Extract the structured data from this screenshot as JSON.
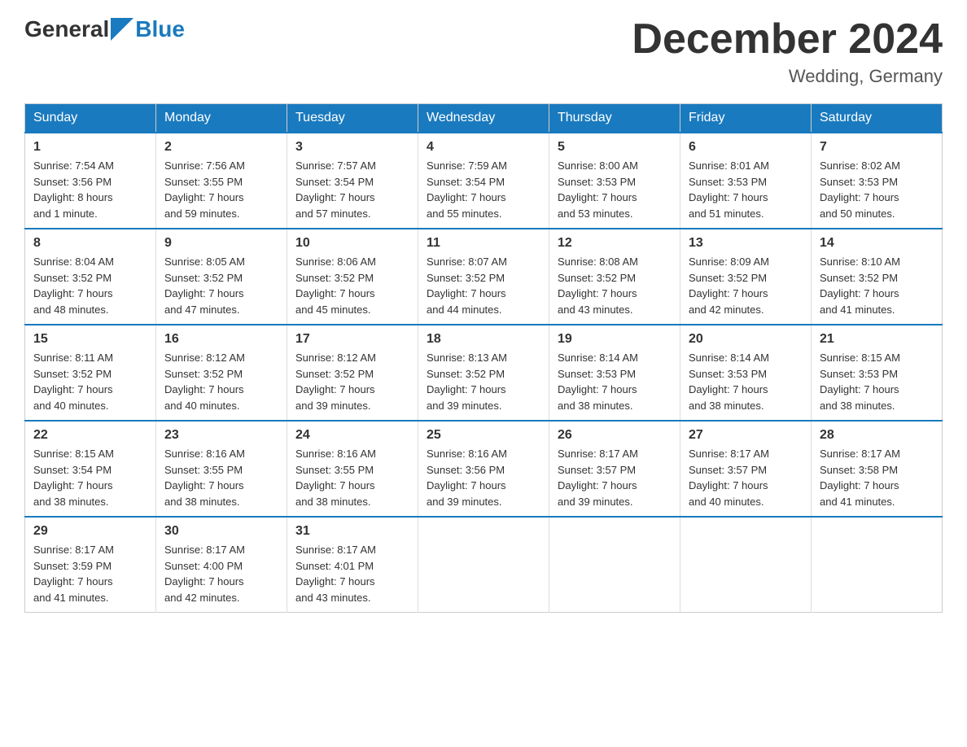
{
  "header": {
    "logo": {
      "part1": "General",
      "part2": "Blue"
    },
    "title": "December 2024",
    "location": "Wedding, Germany"
  },
  "weekdays": [
    "Sunday",
    "Monday",
    "Tuesday",
    "Wednesday",
    "Thursday",
    "Friday",
    "Saturday"
  ],
  "weeks": [
    [
      {
        "day": "1",
        "sunrise": "7:54 AM",
        "sunset": "3:56 PM",
        "daylight": "8 hours and 1 minute."
      },
      {
        "day": "2",
        "sunrise": "7:56 AM",
        "sunset": "3:55 PM",
        "daylight": "7 hours and 59 minutes."
      },
      {
        "day": "3",
        "sunrise": "7:57 AM",
        "sunset": "3:54 PM",
        "daylight": "7 hours and 57 minutes."
      },
      {
        "day": "4",
        "sunrise": "7:59 AM",
        "sunset": "3:54 PM",
        "daylight": "7 hours and 55 minutes."
      },
      {
        "day": "5",
        "sunrise": "8:00 AM",
        "sunset": "3:53 PM",
        "daylight": "7 hours and 53 minutes."
      },
      {
        "day": "6",
        "sunrise": "8:01 AM",
        "sunset": "3:53 PM",
        "daylight": "7 hours and 51 minutes."
      },
      {
        "day": "7",
        "sunrise": "8:02 AM",
        "sunset": "3:53 PM",
        "daylight": "7 hours and 50 minutes."
      }
    ],
    [
      {
        "day": "8",
        "sunrise": "8:04 AM",
        "sunset": "3:52 PM",
        "daylight": "7 hours and 48 minutes."
      },
      {
        "day": "9",
        "sunrise": "8:05 AM",
        "sunset": "3:52 PM",
        "daylight": "7 hours and 47 minutes."
      },
      {
        "day": "10",
        "sunrise": "8:06 AM",
        "sunset": "3:52 PM",
        "daylight": "7 hours and 45 minutes."
      },
      {
        "day": "11",
        "sunrise": "8:07 AM",
        "sunset": "3:52 PM",
        "daylight": "7 hours and 44 minutes."
      },
      {
        "day": "12",
        "sunrise": "8:08 AM",
        "sunset": "3:52 PM",
        "daylight": "7 hours and 43 minutes."
      },
      {
        "day": "13",
        "sunrise": "8:09 AM",
        "sunset": "3:52 PM",
        "daylight": "7 hours and 42 minutes."
      },
      {
        "day": "14",
        "sunrise": "8:10 AM",
        "sunset": "3:52 PM",
        "daylight": "7 hours and 41 minutes."
      }
    ],
    [
      {
        "day": "15",
        "sunrise": "8:11 AM",
        "sunset": "3:52 PM",
        "daylight": "7 hours and 40 minutes."
      },
      {
        "day": "16",
        "sunrise": "8:12 AM",
        "sunset": "3:52 PM",
        "daylight": "7 hours and 40 minutes."
      },
      {
        "day": "17",
        "sunrise": "8:12 AM",
        "sunset": "3:52 PM",
        "daylight": "7 hours and 39 minutes."
      },
      {
        "day": "18",
        "sunrise": "8:13 AM",
        "sunset": "3:52 PM",
        "daylight": "7 hours and 39 minutes."
      },
      {
        "day": "19",
        "sunrise": "8:14 AM",
        "sunset": "3:53 PM",
        "daylight": "7 hours and 38 minutes."
      },
      {
        "day": "20",
        "sunrise": "8:14 AM",
        "sunset": "3:53 PM",
        "daylight": "7 hours and 38 minutes."
      },
      {
        "day": "21",
        "sunrise": "8:15 AM",
        "sunset": "3:53 PM",
        "daylight": "7 hours and 38 minutes."
      }
    ],
    [
      {
        "day": "22",
        "sunrise": "8:15 AM",
        "sunset": "3:54 PM",
        "daylight": "7 hours and 38 minutes."
      },
      {
        "day": "23",
        "sunrise": "8:16 AM",
        "sunset": "3:55 PM",
        "daylight": "7 hours and 38 minutes."
      },
      {
        "day": "24",
        "sunrise": "8:16 AM",
        "sunset": "3:55 PM",
        "daylight": "7 hours and 38 minutes."
      },
      {
        "day": "25",
        "sunrise": "8:16 AM",
        "sunset": "3:56 PM",
        "daylight": "7 hours and 39 minutes."
      },
      {
        "day": "26",
        "sunrise": "8:17 AM",
        "sunset": "3:57 PM",
        "daylight": "7 hours and 39 minutes."
      },
      {
        "day": "27",
        "sunrise": "8:17 AM",
        "sunset": "3:57 PM",
        "daylight": "7 hours and 40 minutes."
      },
      {
        "day": "28",
        "sunrise": "8:17 AM",
        "sunset": "3:58 PM",
        "daylight": "7 hours and 41 minutes."
      }
    ],
    [
      {
        "day": "29",
        "sunrise": "8:17 AM",
        "sunset": "3:59 PM",
        "daylight": "7 hours and 41 minutes."
      },
      {
        "day": "30",
        "sunrise": "8:17 AM",
        "sunset": "4:00 PM",
        "daylight": "7 hours and 42 minutes."
      },
      {
        "day": "31",
        "sunrise": "8:17 AM",
        "sunset": "4:01 PM",
        "daylight": "7 hours and 43 minutes."
      },
      null,
      null,
      null,
      null
    ]
  ],
  "labels": {
    "sunrise_prefix": "Sunrise: ",
    "sunset_prefix": "Sunset: ",
    "daylight_prefix": "Daylight: "
  }
}
